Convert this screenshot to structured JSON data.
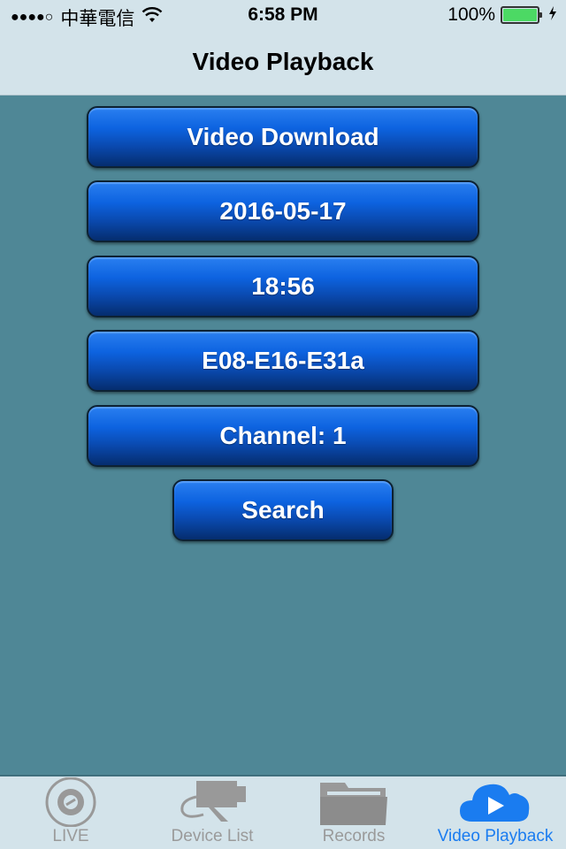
{
  "status_bar": {
    "signal": "●●●●○",
    "carrier": "中華電信",
    "time": "6:58 PM",
    "battery_percent": "100%",
    "battery_level": 1.0,
    "charging": true
  },
  "nav": {
    "title": "Video Playback"
  },
  "buttons": {
    "video_download": "Video Download",
    "date": "2016-05-17",
    "time": "18:56",
    "device": "E08-E16-E31a",
    "channel": "Channel:  1",
    "search": "Search"
  },
  "tabbar": {
    "items": [
      {
        "label": "LIVE",
        "icon": "live-disc-icon",
        "active": false
      },
      {
        "label": "Device List",
        "icon": "camera-icon",
        "active": false
      },
      {
        "label": "Records",
        "icon": "folder-icon",
        "active": false
      },
      {
        "label": "Video Playback",
        "icon": "cloud-play-icon",
        "active": true
      }
    ]
  },
  "colors": {
    "accent": "#1a7cf0",
    "background": "#4f8796",
    "bar": "#d3e3ea",
    "button_blue": "#0d63e0"
  }
}
